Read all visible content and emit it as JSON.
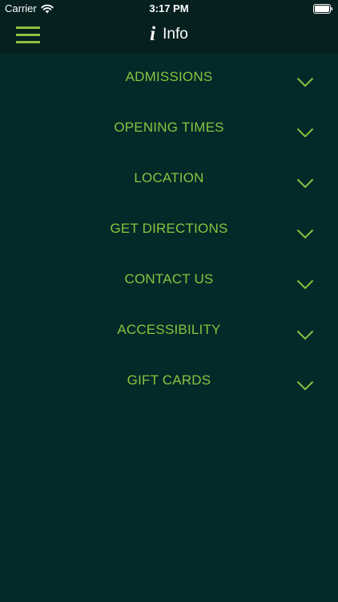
{
  "status": {
    "carrier": "Carrier",
    "time": "3:17 PM"
  },
  "nav": {
    "title": "Info",
    "info_glyph": "i",
    "menu_icon": "hamburger-icon"
  },
  "colors": {
    "background": "#022a29",
    "header": "#05201f",
    "accent": "#8dc13f"
  },
  "sections": [
    {
      "label": "ADMISSIONS"
    },
    {
      "label": "OPENING TIMES"
    },
    {
      "label": "LOCATION"
    },
    {
      "label": "GET DIRECTIONS"
    },
    {
      "label": "CONTACT US"
    },
    {
      "label": "ACCESSIBILITY"
    },
    {
      "label": "GIFT CARDS"
    }
  ]
}
